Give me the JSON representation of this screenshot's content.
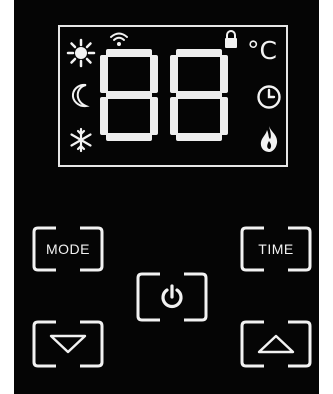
{
  "display": {
    "digits": "88",
    "unit": "°C",
    "icons": [
      "sun-icon",
      "moon-icon",
      "snowflake-icon",
      "wifi-icon",
      "lock-icon",
      "clock-icon",
      "flame-icon"
    ]
  },
  "buttons": {
    "mode_label": "MODE",
    "time_label": "TIME",
    "power_icon": "power-icon",
    "down_icon": "triangle-down-icon",
    "up_icon": "triangle-up-icon"
  },
  "colors": {
    "panel": "#050505",
    "foreground": "#f2f2f2"
  }
}
